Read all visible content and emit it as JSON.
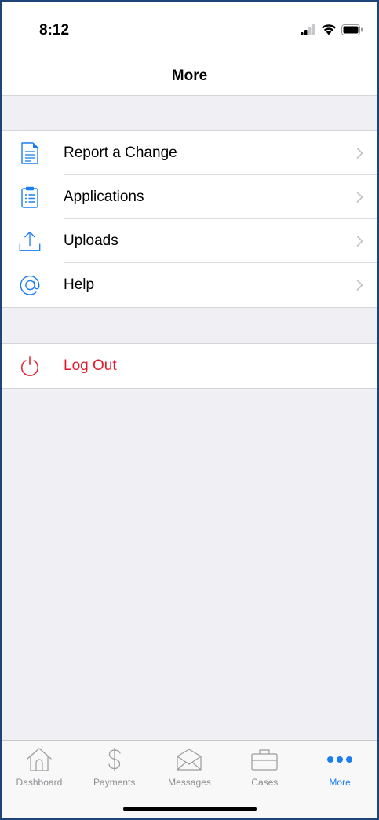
{
  "status_bar": {
    "time": "8:12",
    "icons": [
      "cellular-signal-icon",
      "wifi-icon",
      "battery-icon"
    ]
  },
  "nav": {
    "title": "More"
  },
  "menu": {
    "items": [
      {
        "label": "Report a Change",
        "icon": "document-icon"
      },
      {
        "label": "Applications",
        "icon": "clipboard-icon"
      },
      {
        "label": "Uploads",
        "icon": "upload-icon"
      },
      {
        "label": "Help",
        "icon": "at-sign-icon"
      }
    ]
  },
  "logout": {
    "label": "Log Out",
    "icon": "power-icon"
  },
  "tab_bar": {
    "tabs": [
      {
        "label": "Dashboard",
        "icon": "home-icon"
      },
      {
        "label": "Payments",
        "icon": "dollar-icon"
      },
      {
        "label": "Messages",
        "icon": "envelope-icon"
      },
      {
        "label": "Cases",
        "icon": "briefcase-icon"
      },
      {
        "label": "More",
        "icon": "more-dots-icon",
        "active": true
      }
    ]
  },
  "colors": {
    "accent": "#1a7ef2",
    "destructive": "#e5192a",
    "inactive_tab": "#8e8e93",
    "background": "#efeff4"
  }
}
